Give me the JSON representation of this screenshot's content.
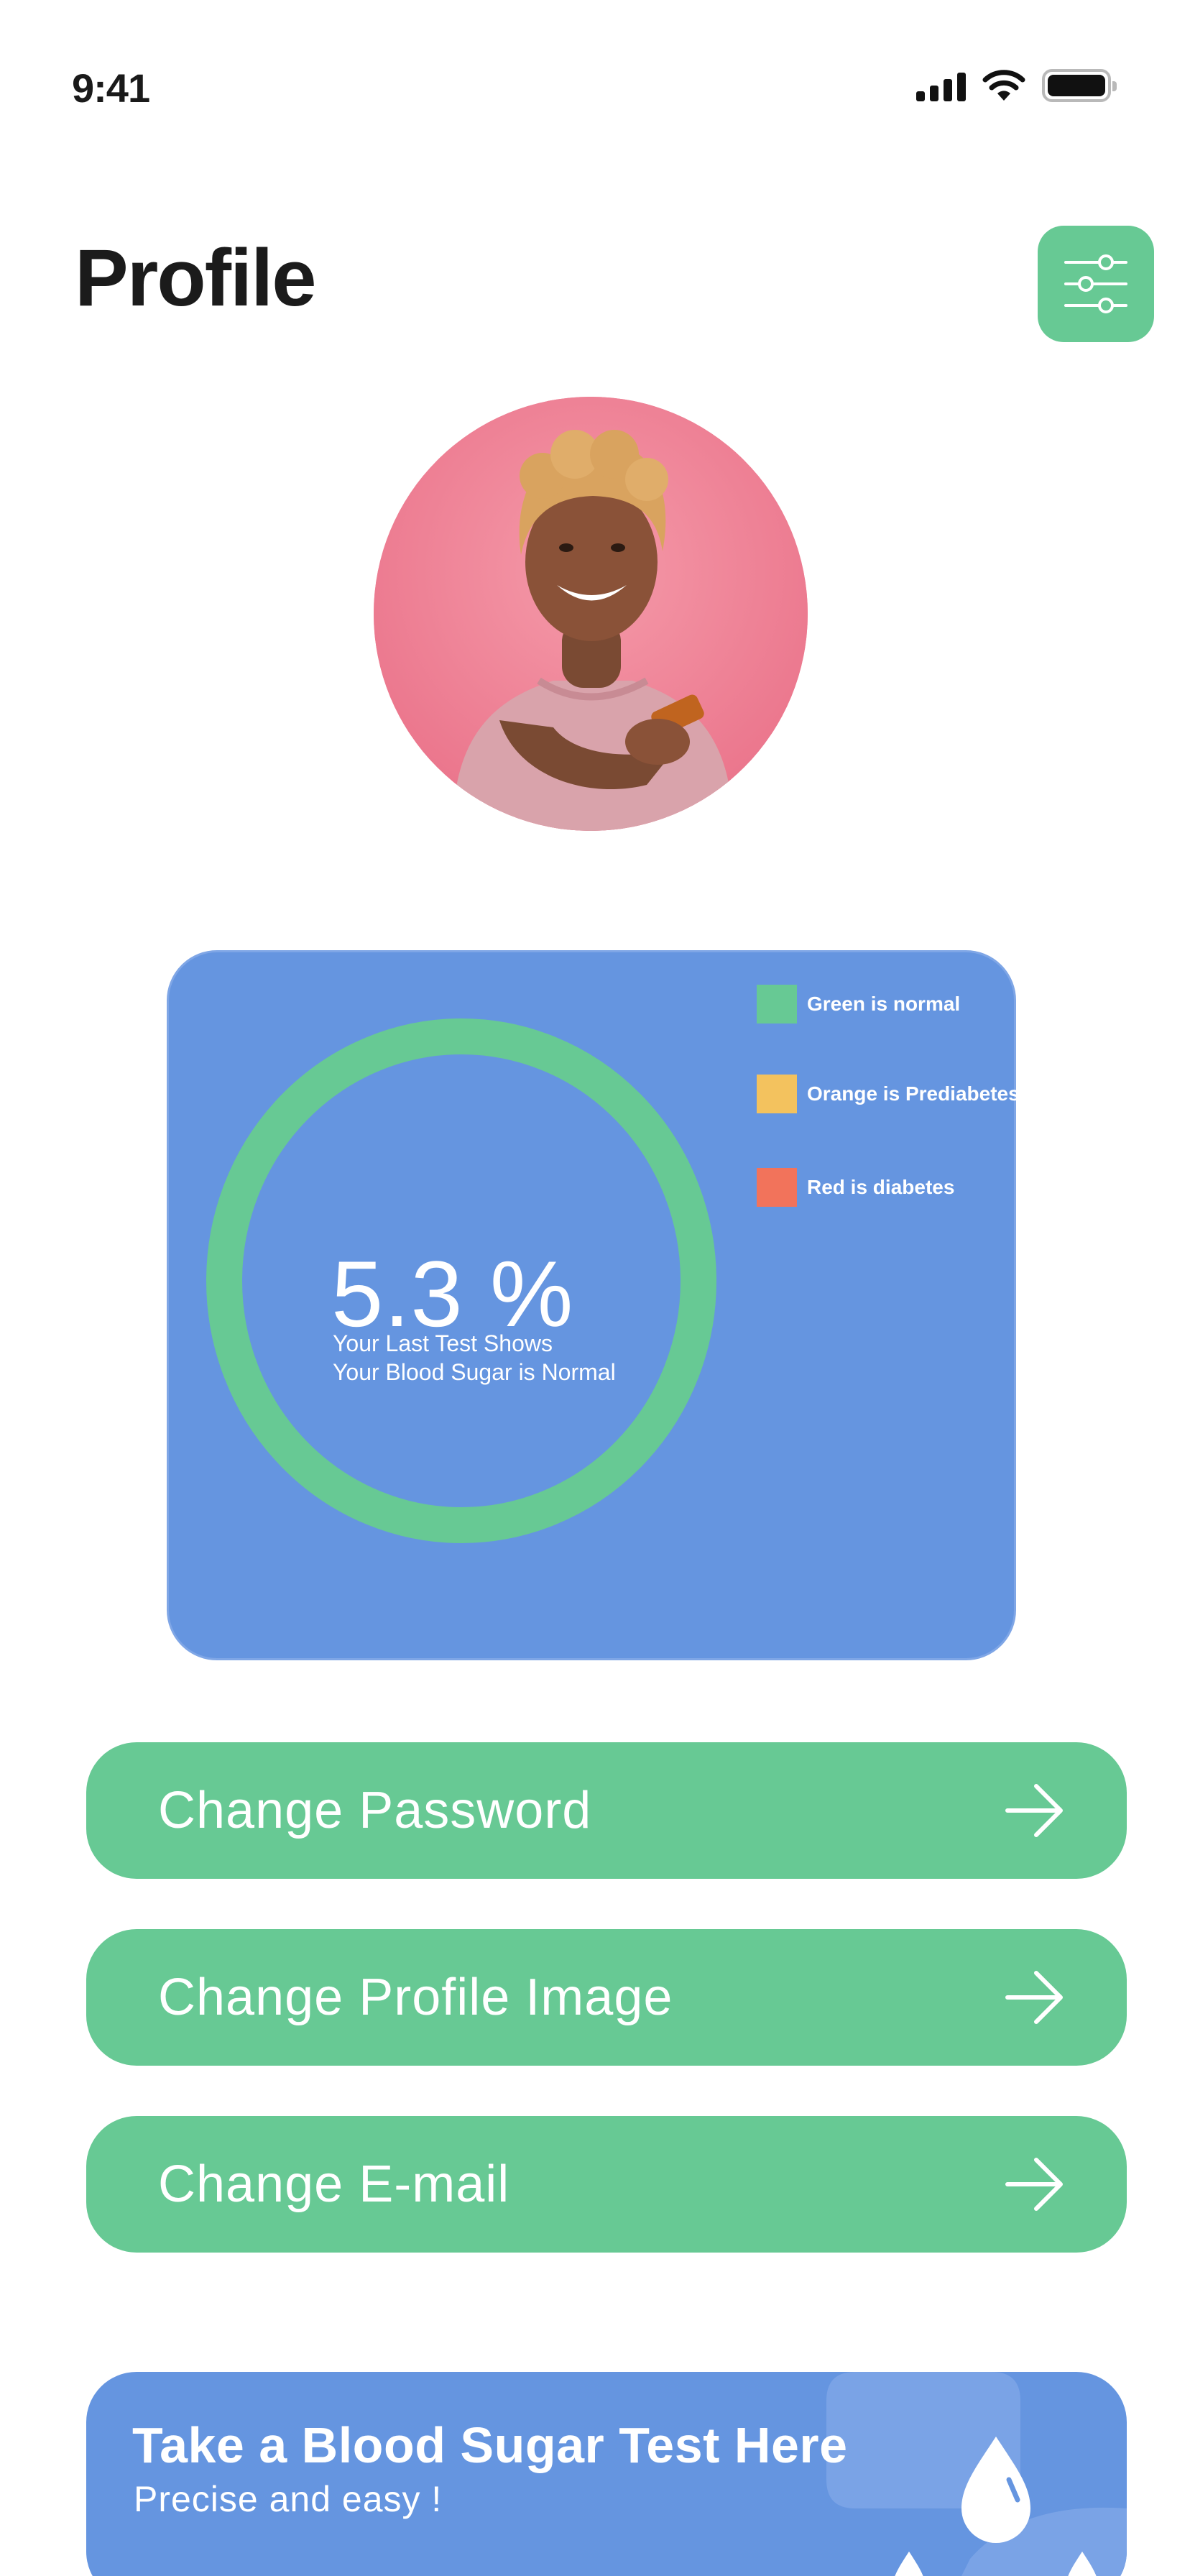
{
  "status_bar": {
    "time": "9:41",
    "icons": [
      "signal-icon",
      "wifi-icon",
      "battery-icon"
    ]
  },
  "header": {
    "title": "Profile",
    "filter_icon": "sliders-icon"
  },
  "avatar": {
    "alt": "profile-photo"
  },
  "test_card": {
    "value": "5.3 %",
    "value_number": 5.3,
    "status_line_1": "Your Last Test Shows",
    "status_line_2": "Your Blood Sugar is Normal",
    "ring_color": "#67c994",
    "legend": [
      {
        "label": "Green is normal",
        "color": "#67c994"
      },
      {
        "label": "Orange is Prediabetes",
        "color": "#f3c25e"
      },
      {
        "label": "Red is diabetes",
        "color": "#f2735b"
      }
    ]
  },
  "actions": [
    {
      "label": "Change Password",
      "icon": "arrow-right-icon"
    },
    {
      "label": "Change Profile Image",
      "icon": "arrow-right-icon"
    },
    {
      "label": "Change E-mail",
      "icon": "arrow-right-icon"
    }
  ],
  "banner": {
    "title": "Take a Blood Sugar Test Here",
    "subtitle": "Precise and easy !",
    "icon": "blood-drop-icon"
  },
  "colors": {
    "accent_green": "#67c994",
    "card_blue": "#6595e0",
    "text_dark": "#1b1b1b"
  }
}
